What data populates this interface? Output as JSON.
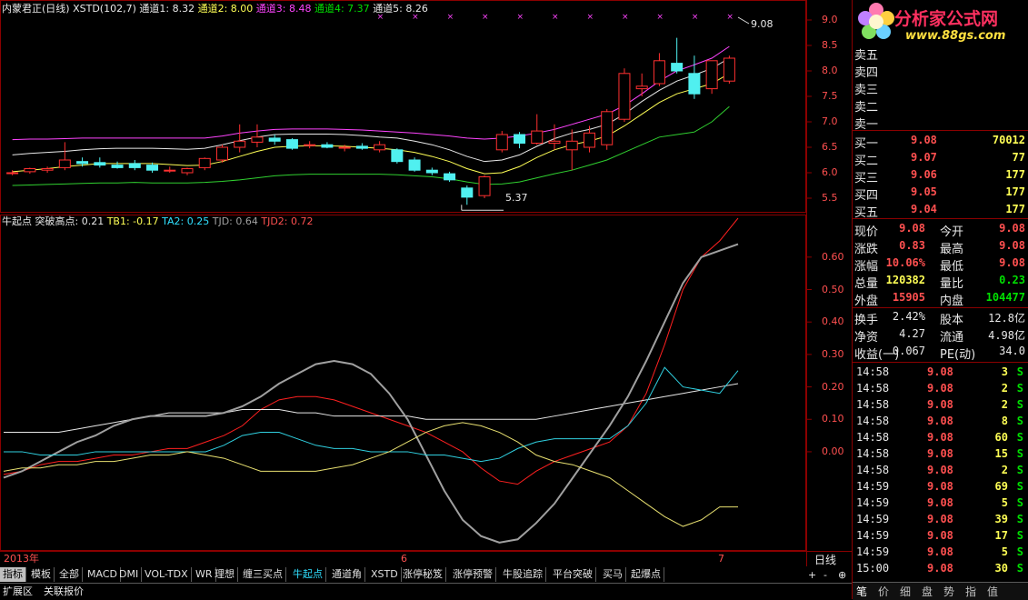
{
  "colors": {
    "bg": "#000000",
    "grid": "#8b0000",
    "up": "#ff3030",
    "down": "#50f0f0",
    "ma_white": "#e8e8e8",
    "ma_yellow": "#ffff55",
    "ma_magenta": "#ff44ff",
    "ma_green": "#30d030",
    "gray": "#a0a0a0"
  },
  "header": {
    "stock": "内蒙君正(日线)",
    "indicator": "XSTD(102,7)",
    "ch1": "通道1: 8.32",
    "ch2": "通道2: 8.00",
    "ch3": "通道3: 8.48",
    "ch4": "通道4: 7.37",
    "ch5": "通道5: 8.26"
  },
  "logo": {
    "title": "分析家公式网",
    "url": "www.88gs.com",
    "brand": "Z",
    "shadow": "THE ANALYST"
  },
  "price_axis": {
    "labels": [
      "9.0",
      "8.5",
      "8.0",
      "7.5",
      "7.0",
      "6.5",
      "6.0",
      "5.5"
    ]
  },
  "price_annotations": {
    "high": "9.08",
    "low": "5.37"
  },
  "ind_header": {
    "name": "牛起点",
    "t0": "突破高点: 0.21",
    "tb1": "TB1: -0.17",
    "ta2": "TA2: 0.25",
    "tjd": "TJD: 0.64",
    "tjd2": "TJD2: 0.72"
  },
  "ind_axis": {
    "labels": [
      "0.60",
      "0.50",
      "0.40",
      "0.30",
      "0.20",
      "0.10",
      "0.00"
    ]
  },
  "date_axis": {
    "labels": [
      "2013年",
      "6",
      "7"
    ],
    "period": "日线"
  },
  "tabs": [
    "指标",
    "模板",
    "全部",
    "MACD",
    "DMI",
    "VOL-TDX",
    "WR",
    "理想",
    "缠三买点",
    "牛起点",
    "通道角",
    "XSTD",
    "涨停秘笈",
    "涨停预警",
    "牛股追踪",
    "平台突破",
    "买马",
    "起爆点"
  ],
  "tab_controls": [
    "+",
    "-",
    "⊕"
  ],
  "bottom_tabs": [
    "扩展区",
    "关联报价"
  ],
  "order_book": {
    "sells": [
      {
        "label": "卖五"
      },
      {
        "label": "卖四"
      },
      {
        "label": "卖三"
      },
      {
        "label": "卖二"
      },
      {
        "label": "卖一"
      }
    ],
    "buys": [
      {
        "label": "买一",
        "price": "9.08",
        "vol": "70012"
      },
      {
        "label": "买二",
        "price": "9.07",
        "vol": "77"
      },
      {
        "label": "买三",
        "price": "9.06",
        "vol": "177"
      },
      {
        "label": "买四",
        "price": "9.05",
        "vol": "177"
      },
      {
        "label": "买五",
        "price": "9.04",
        "vol": "177"
      }
    ]
  },
  "quote": [
    {
      "l1": "现价",
      "v1": "9.08",
      "l2": "今开",
      "v2": "9.08"
    },
    {
      "l1": "涨跌",
      "v1": "0.83",
      "l2": "最高",
      "v2": "9.08"
    },
    {
      "l1": "涨幅",
      "v1": "10.06%",
      "l2": "最低",
      "v2": "9.08"
    },
    {
      "l1": "总量",
      "v1": "120382",
      "l2": "量比",
      "v2": "0.23"
    },
    {
      "l1": "外盘",
      "v1": "15905",
      "l2": "内盘",
      "v2": "104477"
    }
  ],
  "fundamentals": [
    {
      "l1": "换手",
      "v1": "2.42%",
      "l2": "股本",
      "v2": "12.8亿"
    },
    {
      "l1": "净资",
      "v1": "4.27",
      "l2": "流通",
      "v2": "4.98亿"
    },
    {
      "l1": "收益(一)",
      "v1": "0.067",
      "l2": "PE(动)",
      "v2": "34.0"
    }
  ],
  "ticks": [
    {
      "time": "14:58",
      "price": "9.08",
      "vol": "3",
      "side": "S"
    },
    {
      "time": "14:58",
      "price": "9.08",
      "vol": "2",
      "side": "S"
    },
    {
      "time": "14:58",
      "price": "9.08",
      "vol": "2",
      "side": "S"
    },
    {
      "time": "14:58",
      "price": "9.08",
      "vol": "8",
      "side": "S"
    },
    {
      "time": "14:58",
      "price": "9.08",
      "vol": "60",
      "side": "S"
    },
    {
      "time": "14:58",
      "price": "9.08",
      "vol": "15",
      "side": "S"
    },
    {
      "time": "14:58",
      "price": "9.08",
      "vol": "2",
      "side": "S"
    },
    {
      "time": "14:59",
      "price": "9.08",
      "vol": "69",
      "side": "S"
    },
    {
      "time": "14:59",
      "price": "9.08",
      "vol": "5",
      "side": "S"
    },
    {
      "time": "14:59",
      "price": "9.08",
      "vol": "39",
      "side": "S"
    },
    {
      "time": "14:59",
      "price": "9.08",
      "vol": "17",
      "side": "S"
    },
    {
      "time": "14:59",
      "price": "9.08",
      "vol": "5",
      "side": "S"
    },
    {
      "time": "15:00",
      "price": "9.08",
      "vol": "30",
      "side": "S"
    }
  ],
  "right_tabs": [
    "笔",
    "价",
    "细",
    "盘",
    "势",
    "指",
    "值"
  ],
  "chart_data": [
    {
      "type": "candlestick",
      "title": "内蒙君正(日线)",
      "ylim": [
        5.25,
        9.25
      ],
      "candles": [
        {
          "o": 6.0,
          "h": 6.05,
          "l": 5.95,
          "c": 6.0
        },
        {
          "o": 6.02,
          "h": 6.1,
          "l": 5.98,
          "c": 6.08
        },
        {
          "o": 6.05,
          "h": 6.12,
          "l": 6.0,
          "c": 6.08
        },
        {
          "o": 6.1,
          "h": 6.6,
          "l": 6.05,
          "c": 6.25
        },
        {
          "o": 6.22,
          "h": 6.3,
          "l": 6.12,
          "c": 6.18
        },
        {
          "o": 6.2,
          "h": 6.3,
          "l": 6.1,
          "c": 6.15
        },
        {
          "o": 6.15,
          "h": 6.22,
          "l": 6.08,
          "c": 6.1
        },
        {
          "o": 6.18,
          "h": 6.25,
          "l": 6.05,
          "c": 6.1
        },
        {
          "o": 6.15,
          "h": 6.2,
          "l": 6.0,
          "c": 6.05
        },
        {
          "o": 6.05,
          "h": 6.12,
          "l": 6.0,
          "c": 6.05
        },
        {
          "o": 6.0,
          "h": 6.1,
          "l": 5.95,
          "c": 6.08
        },
        {
          "o": 6.1,
          "h": 6.3,
          "l": 6.05,
          "c": 6.28
        },
        {
          "o": 6.25,
          "h": 6.55,
          "l": 6.2,
          "c": 6.5
        },
        {
          "o": 6.5,
          "h": 6.95,
          "l": 6.4,
          "c": 6.62
        },
        {
          "o": 6.6,
          "h": 6.95,
          "l": 6.5,
          "c": 6.7
        },
        {
          "o": 6.68,
          "h": 6.75,
          "l": 6.55,
          "c": 6.62
        },
        {
          "o": 6.65,
          "h": 6.68,
          "l": 6.45,
          "c": 6.48
        },
        {
          "o": 6.55,
          "h": 6.62,
          "l": 6.48,
          "c": 6.55
        },
        {
          "o": 6.55,
          "h": 6.6,
          "l": 6.48,
          "c": 6.5
        },
        {
          "o": 6.5,
          "h": 6.55,
          "l": 6.42,
          "c": 6.5
        },
        {
          "o": 6.52,
          "h": 6.58,
          "l": 6.45,
          "c": 6.48
        },
        {
          "o": 6.45,
          "h": 6.62,
          "l": 6.4,
          "c": 6.55
        },
        {
          "o": 6.45,
          "h": 6.48,
          "l": 6.18,
          "c": 6.22
        },
        {
          "o": 6.25,
          "h": 6.3,
          "l": 6.02,
          "c": 6.05
        },
        {
          "o": 6.05,
          "h": 6.1,
          "l": 5.95,
          "c": 6.0
        },
        {
          "o": 5.98,
          "h": 6.02,
          "l": 5.82,
          "c": 5.86
        },
        {
          "o": 5.7,
          "h": 5.75,
          "l": 5.37,
          "c": 5.52
        },
        {
          "o": 5.55,
          "h": 5.95,
          "l": 5.5,
          "c": 5.92
        },
        {
          "o": 6.45,
          "h": 6.82,
          "l": 6.4,
          "c": 6.75
        },
        {
          "o": 6.75,
          "h": 6.8,
          "l": 6.48,
          "c": 6.58
        },
        {
          "o": 6.58,
          "h": 7.15,
          "l": 6.55,
          "c": 6.82
        },
        {
          "o": 6.58,
          "h": 6.95,
          "l": 6.45,
          "c": 6.62
        },
        {
          "o": 6.45,
          "h": 6.85,
          "l": 6.05,
          "c": 6.62
        },
        {
          "o": 6.5,
          "h": 6.92,
          "l": 6.4,
          "c": 6.78
        },
        {
          "o": 6.55,
          "h": 7.25,
          "l": 6.45,
          "c": 7.2
        },
        {
          "o": 7.05,
          "h": 8.05,
          "l": 7.0,
          "c": 7.95
        },
        {
          "o": 7.65,
          "h": 7.95,
          "l": 7.5,
          "c": 7.7
        },
        {
          "o": 7.75,
          "h": 8.35,
          "l": 7.7,
          "c": 8.2
        },
        {
          "o": 8.15,
          "h": 8.65,
          "l": 7.95,
          "c": 8.0
        },
        {
          "o": 7.95,
          "h": 8.3,
          "l": 7.45,
          "c": 7.55
        },
        {
          "o": 7.65,
          "h": 8.2,
          "l": 7.55,
          "c": 8.2
        },
        {
          "o": 7.8,
          "h": 8.3,
          "l": 7.75,
          "c": 8.25
        }
      ],
      "series": [
        {
          "values": [
            5.75,
            5.76,
            5.77,
            5.78,
            5.79,
            5.8,
            5.8,
            5.81,
            5.8,
            5.8,
            5.8,
            5.81,
            5.83,
            5.86,
            5.9,
            5.94,
            5.96,
            5.97,
            5.97,
            5.97,
            5.97,
            5.97,
            5.96,
            5.94,
            5.92,
            5.88,
            5.82,
            5.77,
            5.78,
            5.82,
            5.9,
            5.98,
            6.05,
            6.15,
            6.25,
            6.4,
            6.55,
            6.7,
            6.75,
            6.8,
            7.0,
            7.3
          ]
        },
        {
          "values": [
            6.02,
            6.05,
            6.08,
            6.12,
            6.15,
            6.18,
            6.18,
            6.18,
            6.18,
            6.16,
            6.14,
            6.15,
            6.22,
            6.32,
            6.42,
            6.5,
            6.52,
            6.53,
            6.53,
            6.52,
            6.5,
            6.48,
            6.45,
            6.4,
            6.32,
            6.22,
            6.08,
            5.98,
            6.0,
            6.12,
            6.3,
            6.45,
            6.55,
            6.62,
            6.72,
            6.92,
            7.15,
            7.38,
            7.55,
            7.65,
            7.75,
            7.95
          ]
        },
        {
          "values": [
            6.35,
            6.38,
            6.4,
            6.42,
            6.45,
            6.47,
            6.48,
            6.48,
            6.48,
            6.47,
            6.46,
            6.48,
            6.55,
            6.63,
            6.7,
            6.75,
            6.76,
            6.76,
            6.76,
            6.75,
            6.73,
            6.7,
            6.68,
            6.62,
            6.55,
            6.45,
            6.32,
            6.22,
            6.25,
            6.35,
            6.52,
            6.67,
            6.78,
            6.85,
            6.95,
            7.15,
            7.4,
            7.62,
            7.8,
            7.92,
            8.05,
            8.25
          ]
        },
        {
          "values": [
            6.65,
            6.66,
            6.66,
            6.67,
            6.68,
            6.68,
            6.68,
            6.68,
            6.68,
            6.68,
            6.68,
            6.68,
            6.72,
            6.78,
            6.82,
            6.85,
            6.86,
            6.86,
            6.86,
            6.85,
            6.84,
            6.82,
            6.8,
            6.78,
            6.75,
            6.72,
            6.68,
            6.66,
            6.68,
            6.72,
            6.78,
            6.85,
            6.95,
            7.05,
            7.15,
            7.32,
            7.55,
            7.8,
            8.0,
            8.12,
            8.25,
            8.48
          ]
        }
      ]
    },
    {
      "type": "line",
      "ylim": [
        -0.3,
        0.72
      ],
      "series": [
        {
          "values": [
            -0.07,
            -0.06,
            -0.04,
            -0.03,
            -0.03,
            -0.02,
            -0.01,
            -0.01,
            0.0,
            0.01,
            0.01,
            0.03,
            0.05,
            0.08,
            0.13,
            0.16,
            0.17,
            0.17,
            0.16,
            0.14,
            0.12,
            0.1,
            0.08,
            0.06,
            0.03,
            0.0,
            -0.05,
            -0.09,
            -0.1,
            -0.06,
            -0.03,
            -0.01,
            0.01,
            0.03,
            0.08,
            0.18,
            0.33,
            0.5,
            0.6,
            0.65,
            0.72
          ]
        },
        {
          "values": [
            0.06,
            0.06,
            0.06,
            0.06,
            0.07,
            0.08,
            0.09,
            0.1,
            0.11,
            0.12,
            0.12,
            0.12,
            0.12,
            0.13,
            0.13,
            0.13,
            0.12,
            0.12,
            0.11,
            0.11,
            0.11,
            0.11,
            0.11,
            0.1,
            0.1,
            0.1,
            0.1,
            0.1,
            0.1,
            0.1,
            0.11,
            0.12,
            0.13,
            0.14,
            0.15,
            0.16,
            0.17,
            0.18,
            0.19,
            0.2,
            0.21
          ]
        },
        {
          "values": [
            -0.08,
            -0.06,
            -0.03,
            0.0,
            0.03,
            0.05,
            0.08,
            0.1,
            0.11,
            0.11,
            0.11,
            0.11,
            0.12,
            0.14,
            0.17,
            0.21,
            0.24,
            0.27,
            0.28,
            0.27,
            0.24,
            0.18,
            0.1,
            -0.01,
            -0.12,
            -0.21,
            -0.26,
            -0.28,
            -0.27,
            -0.22,
            -0.16,
            -0.08,
            0.0,
            0.08,
            0.17,
            0.28,
            0.4,
            0.52,
            0.6,
            0.62,
            0.64
          ]
        },
        {
          "values": [
            0.0,
            0.0,
            -0.01,
            -0.01,
            -0.01,
            0.0,
            0.0,
            0.0,
            0.0,
            0.0,
            0.0,
            0.0,
            0.02,
            0.05,
            0.06,
            0.06,
            0.04,
            0.02,
            0.01,
            0.01,
            0.0,
            0.0,
            0.0,
            -0.01,
            -0.01,
            -0.02,
            -0.03,
            -0.02,
            0.01,
            0.03,
            0.04,
            0.04,
            0.04,
            0.04,
            0.08,
            0.15,
            0.26,
            0.2,
            0.19,
            0.18,
            0.25
          ]
        },
        {
          "values": [
            -0.06,
            -0.05,
            -0.05,
            -0.04,
            -0.04,
            -0.03,
            -0.03,
            -0.02,
            -0.01,
            -0.01,
            0.0,
            -0.01,
            -0.02,
            -0.04,
            -0.06,
            -0.06,
            -0.06,
            -0.06,
            -0.05,
            -0.04,
            -0.02,
            0.0,
            0.03,
            0.06,
            0.08,
            0.09,
            0.08,
            0.06,
            0.03,
            -0.01,
            -0.03,
            -0.04,
            -0.06,
            -0.08,
            -0.12,
            -0.16,
            -0.2,
            -0.23,
            -0.21,
            -0.17,
            -0.17
          ]
        }
      ]
    }
  ]
}
